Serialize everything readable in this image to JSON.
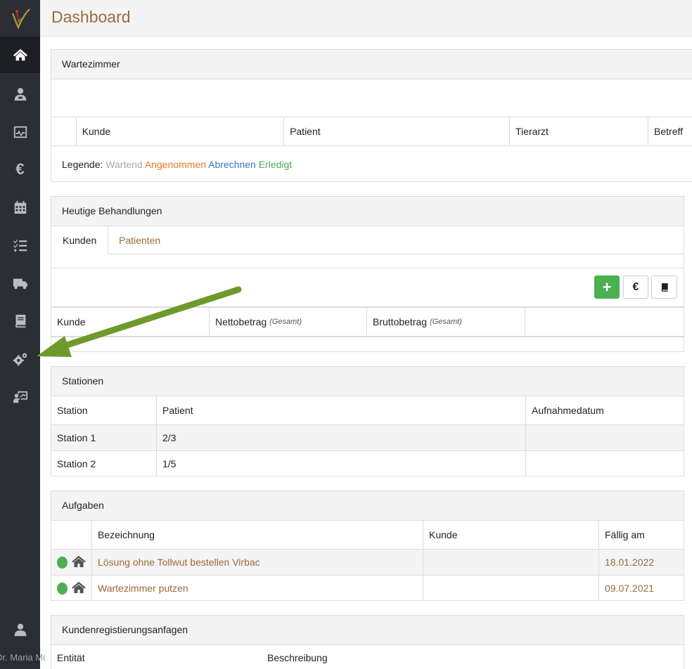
{
  "header": {
    "title": "Dashboard"
  },
  "user": {
    "name": "Dr. Maria Müller"
  },
  "waiting_room": {
    "title": "Wartezimmer",
    "columns": [
      "Kunde",
      "Patient",
      "Tierarzt",
      "Betreff"
    ],
    "legend_label": "Legende:",
    "legend": {
      "waiting": "Wartend",
      "accepted": "Angenommen",
      "billing": "Abrechnen",
      "done": "Erledigt"
    }
  },
  "treatments": {
    "title": "Heutige Behandlungen",
    "tabs": [
      "Kunden",
      "Patienten"
    ],
    "buttons": {
      "add": "+",
      "euro": "€"
    },
    "columns": {
      "customer": "Kunde",
      "net": "Nettobetrag",
      "gross": "Bruttobetrag",
      "total_note": "(Gesamt)"
    }
  },
  "stations": {
    "title": "Stationen",
    "columns": [
      "Station",
      "Patient",
      "Aufnahmedatum"
    ],
    "rows": [
      {
        "station": "Station 1",
        "patient": "2/3",
        "date": ""
      },
      {
        "station": "Station 2",
        "patient": "1/5",
        "date": ""
      }
    ]
  },
  "tasks": {
    "title": "Aufgaben",
    "columns": [
      "Bezeichnung",
      "Kunde",
      "Fällig am"
    ],
    "rows": [
      {
        "name": "Lösung ohne Tollwut bestellen Virbac",
        "customer": "",
        "due": "18.01.2022"
      },
      {
        "name": "Wartezimmer putzen",
        "customer": "",
        "due": "09.07.2021"
      }
    ]
  },
  "registrations": {
    "title": "Kundenregistierungsanfagen",
    "columns": [
      "Entität",
      "Beschreibung"
    ]
  },
  "colors": {
    "accent": "#9a6b3a",
    "sidebar": "#2b2e33",
    "green": "#4caf50",
    "arrow": "#6e9a2c"
  }
}
